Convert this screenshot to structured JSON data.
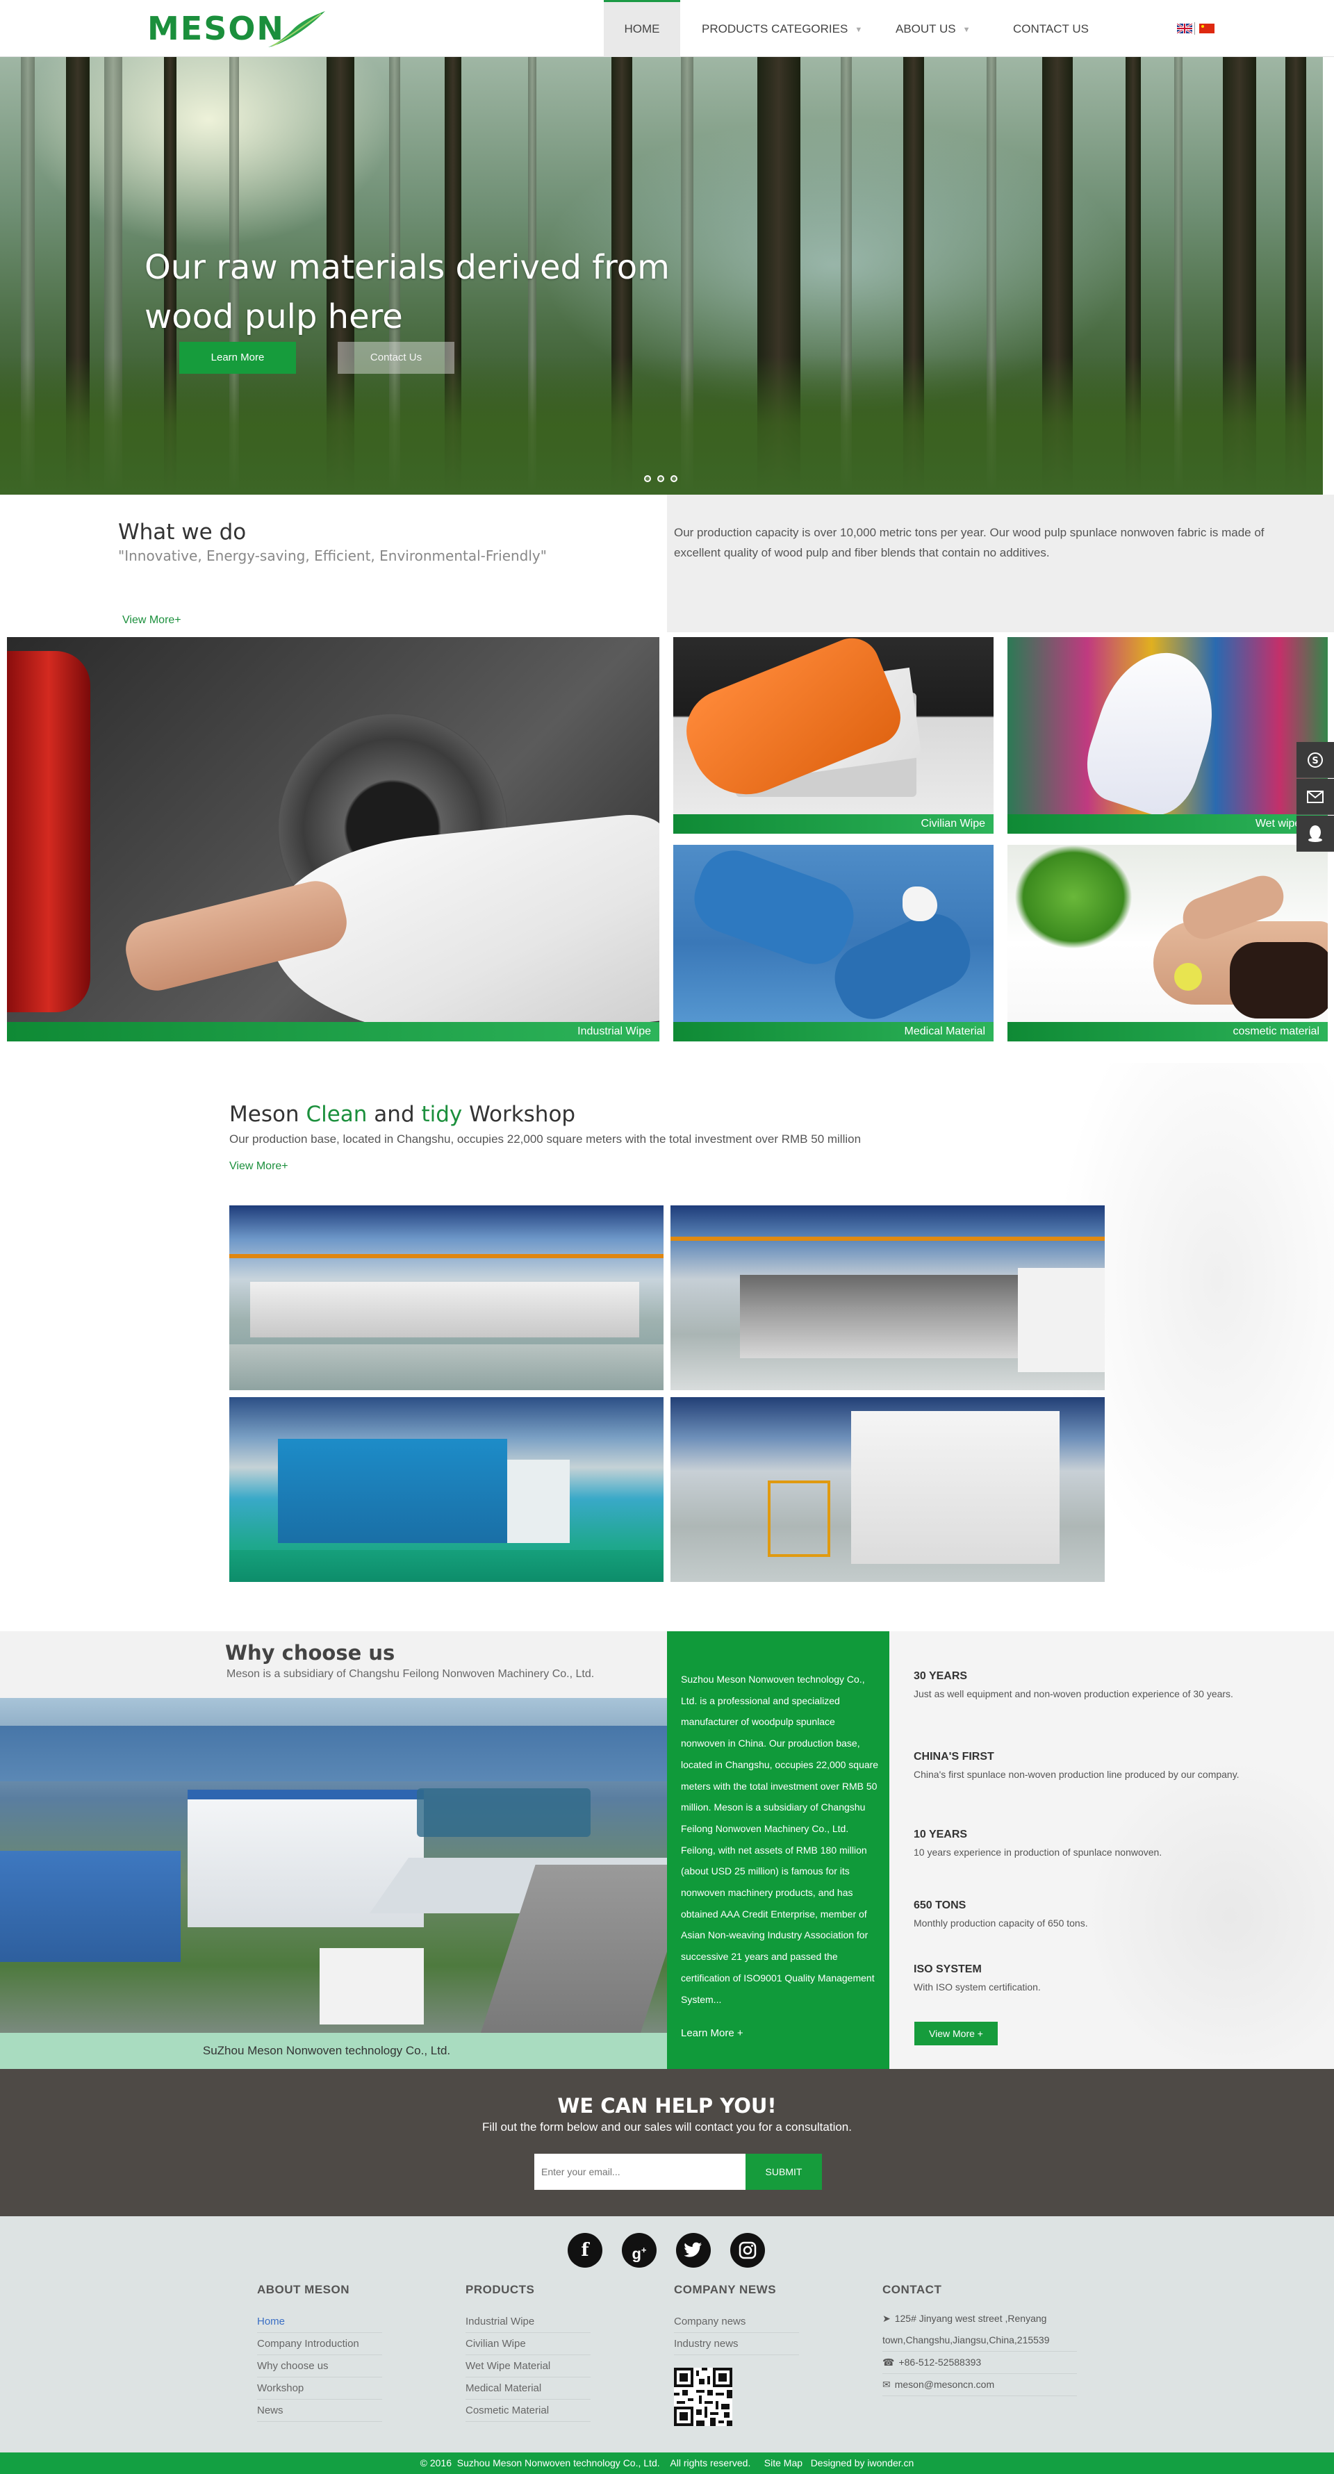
{
  "header": {
    "logo_text": "MESON",
    "nav": [
      {
        "label": "HOME"
      },
      {
        "label": "PRODUCTS CATEGORIES"
      },
      {
        "label": "ABOUT US"
      },
      {
        "label": "CONTACT US"
      }
    ]
  },
  "hero": {
    "title": "Our raw materials derived from wood pulp here",
    "learn_more": "Learn More",
    "contact_us": "Contact Us"
  },
  "what_we_do": {
    "title": "What we do",
    "slogan": "\"Innovative, Energy-saving, Efficient, Environmental-Friendly\"",
    "view_more": "View More+",
    "description": "Our production capacity is over 10,000 metric tons per year. Our wood pulp spunlace nonwoven fabric is made of excellent quality of wood pulp and fiber blends that contain no additives.",
    "tiles": [
      {
        "caption": "Industrial Wipe"
      },
      {
        "caption": "Civilian Wipe"
      },
      {
        "caption": "Wet wipe Ma"
      },
      {
        "caption": "Medical Material"
      },
      {
        "caption": "cosmetic material"
      }
    ]
  },
  "workshop": {
    "title_1": "Meson",
    "title_2": "Clean",
    "title_3": "and",
    "title_4": "tidy",
    "title_5": "Workshop",
    "description": "Our production base, located in Changshu, occupies 22,000 square meters with the total investment over RMB 50 million",
    "view_more": "View More+"
  },
  "why": {
    "title": "Why choose us",
    "subtitle": "Meson is a subsidiary of Changshu Feilong Nonwoven Machinery Co., Ltd.",
    "image_caption": "SuZhou Meson Nonwoven technology Co., Ltd.",
    "body": "Suzhou Meson Nonwoven technology Co., Ltd. is a professional and specialized manufacturer of woodpulp spunlace nonwoven in China. Our production base, located in Changshu, occupies 22,000 square meters with the total investment over RMB 50 million. Meson is a subsidiary of Changshu Feilong Nonwoven Machinery Co., Ltd. Feilong, with net assets of RMB 180 million (about USD 25 million) is famous for its nonwoven machinery products, and has obtained AAA Credit Enterprise, member of Asian Non-weaving Industry Association for successive 21 years and passed the certification of ISO9001 Quality Management System...",
    "learn_more": "Learn More +",
    "features": [
      {
        "title": "30 YEARS",
        "text": "Just as well equipment and non-woven production experience of 30 years."
      },
      {
        "title": "CHINA'S FIRST",
        "text": "China's first spunlace non-woven production line produced by our company."
      },
      {
        "title": "10 YEARS",
        "text": "10 years experience in production of spunlace nonwoven."
      },
      {
        "title": "650 TONS",
        "text": "Monthly production capacity of 650 tons."
      },
      {
        "title": "ISO SYSTEM",
        "text": "With ISO system certification."
      }
    ],
    "view_more": "View More +"
  },
  "help": {
    "title": "WE CAN HELP YOU!",
    "subtitle": "Fill out the form below and our sales will contact you for a consultation.",
    "email_placeholder": "Enter your email...",
    "submit": "SUBMIT"
  },
  "footer": {
    "columns": [
      {
        "title": "ABOUT MESON",
        "items": [
          "Home",
          "Company Introduction",
          "Why choose us",
          "Workshop",
          "News"
        ]
      },
      {
        "title": "PRODUCTS",
        "items": [
          "Industrial Wipe",
          "Civilian Wipe",
          "Wet Wipe Material",
          "Medical Material",
          "Cosmetic Material"
        ]
      },
      {
        "title": "COMPANY NEWS",
        "items": [
          "Company news",
          "Industry news"
        ]
      },
      {
        "title": "CONTACT",
        "items": []
      }
    ],
    "contact": {
      "address": "125# Jinyang west street ,Renyang town,Changshu,Jiangsu,China,215539",
      "phone": "+86-512-52588393",
      "email": "meson@mesoncn.com"
    },
    "copyright": "© 2016  Suzhou Meson Nonwoven technology Co., Ltd.    All rights reserved.     Site Map   Designed by iwonder.cn"
  },
  "colors": {
    "brand_green": "#169c3c",
    "dark_band": "#4e4a46",
    "footer_bg": "#dde3e3"
  }
}
